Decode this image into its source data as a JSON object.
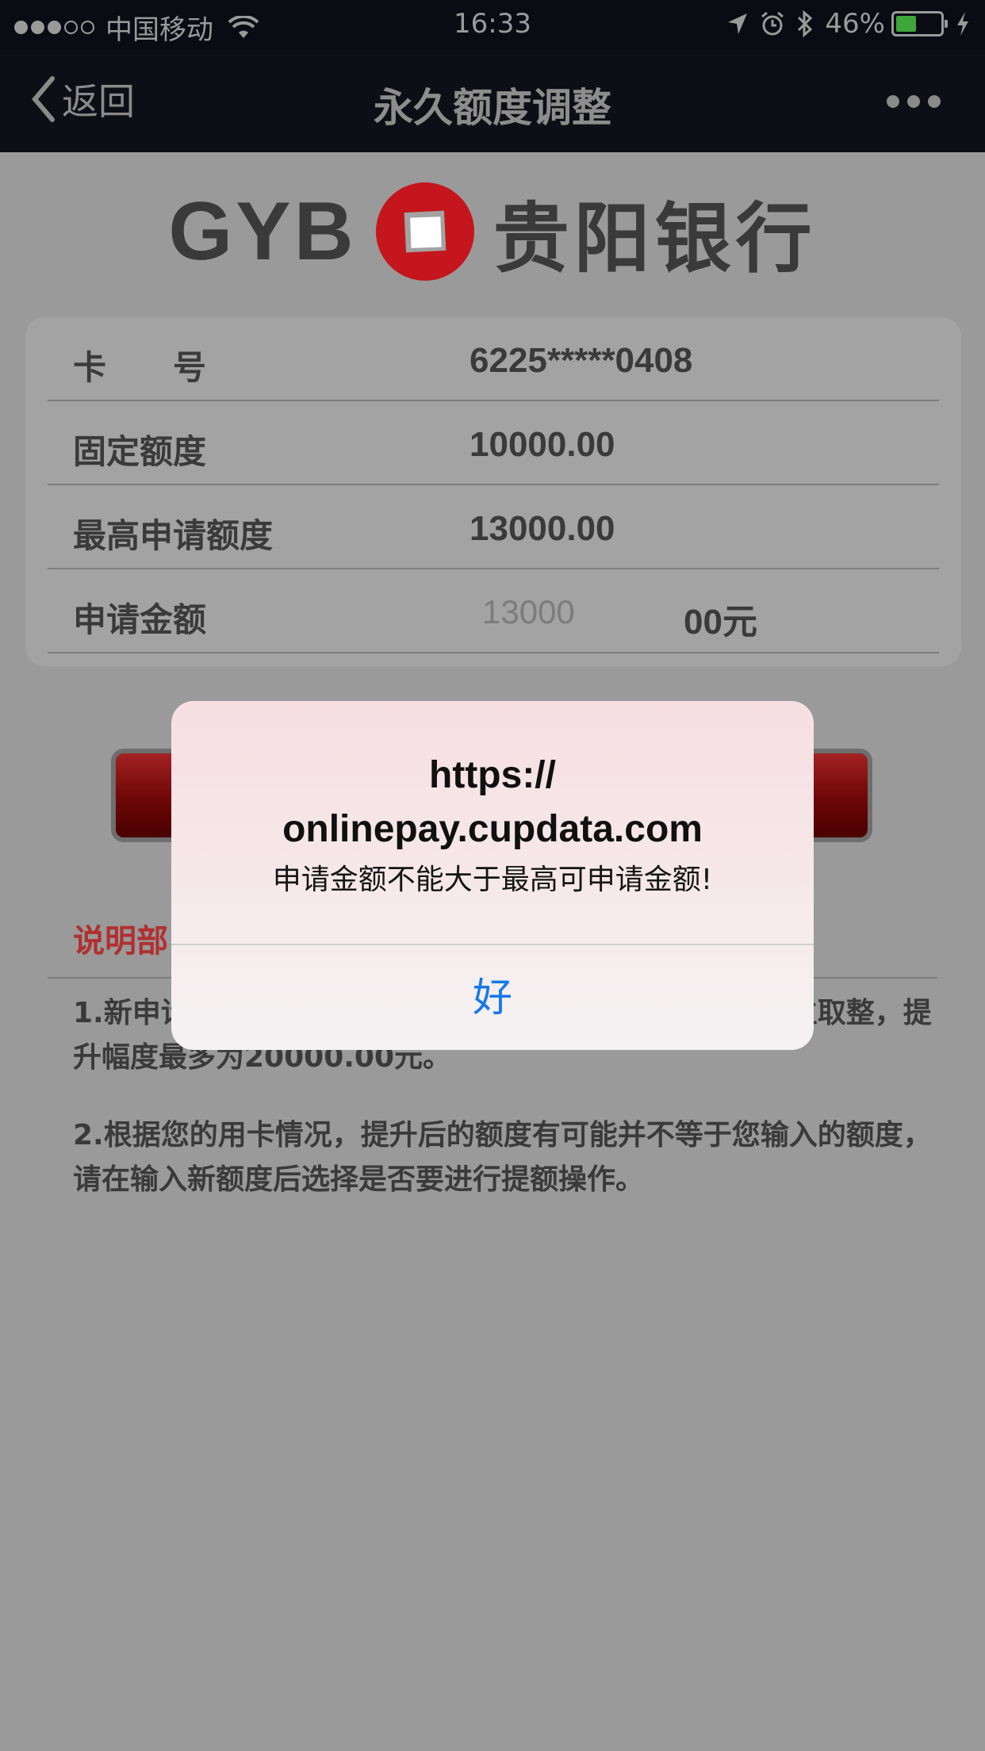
{
  "status_bar": {
    "carrier": "中国移动",
    "time": "16:33",
    "battery": "46%",
    "battery_level": 0.46,
    "colors": {
      "battery_fill": "#3fa63a"
    }
  },
  "nav": {
    "back_label": "返回",
    "title": "永久额度调整"
  },
  "logo": {
    "english": "GYB",
    "chinese": "贵阳银行",
    "mark_color": "#c4161c"
  },
  "card": {
    "rows": [
      {
        "label": "卡　　号",
        "value": "6225*****0408"
      },
      {
        "label": "固定额度",
        "value": "10000.00"
      },
      {
        "label": "最高申请额度",
        "value": "13000.00"
      },
      {
        "label": "申请金额",
        "input_value": "13000",
        "suffix": "00元"
      }
    ]
  },
  "explanation": {
    "title": "说明部",
    "note1": "1.新申请　　　　　　　　　　　　　　　　　　　以百位取整，提升幅度最多为20000.00元。",
    "note2": "2.根据您的用卡情况，提升后的额度有可能并不等于您输入的额度，请在输入新额度后选择是否要进行提额操作。"
  },
  "alert": {
    "title_line1": "https://",
    "title_line2": "onlinepay.cupdata.com",
    "message": "申请金额不能大于最高可申请金额!",
    "ok_label": "好",
    "ok_color": "#1678e8"
  }
}
